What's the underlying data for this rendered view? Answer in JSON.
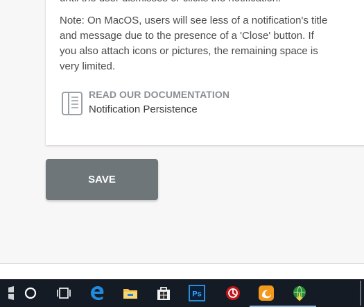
{
  "notification_settings": {
    "clipped_text": "until the user dismisses or clicks the notification.",
    "note_text": "Note: On MacOS, users will see less of a notification's title and message due to the presence of a 'Close' button. If you also attach icons or pictures, the remaining space is very limited.",
    "documentation": {
      "heading": "READ OUR DOCUMENTATION",
      "link_label": "Notification Persistence",
      "icon": "document-icon"
    }
  },
  "actions": {
    "save_label": "SAVE"
  },
  "colors": {
    "save_button": "#6e7679",
    "page_background": "#f7f7f7",
    "taskbar": "#151b24",
    "doc_heading": "#8a8f93"
  },
  "taskbar": {
    "items": [
      {
        "name": "start-icon",
        "active": false
      },
      {
        "name": "cortana-search-icon",
        "active": false
      },
      {
        "name": "task-view-icon",
        "active": false
      },
      {
        "name": "edge-browser-icon",
        "active": false
      },
      {
        "name": "file-explorer-icon",
        "active": false
      },
      {
        "name": "store-icon",
        "active": false
      },
      {
        "name": "photoshop-icon",
        "active": false
      },
      {
        "name": "app-icon",
        "active": false
      },
      {
        "name": "uc-browser-icon",
        "active": true
      },
      {
        "name": "internet-download-manager-icon",
        "active": true
      }
    ],
    "photoshop_label": "Ps"
  }
}
